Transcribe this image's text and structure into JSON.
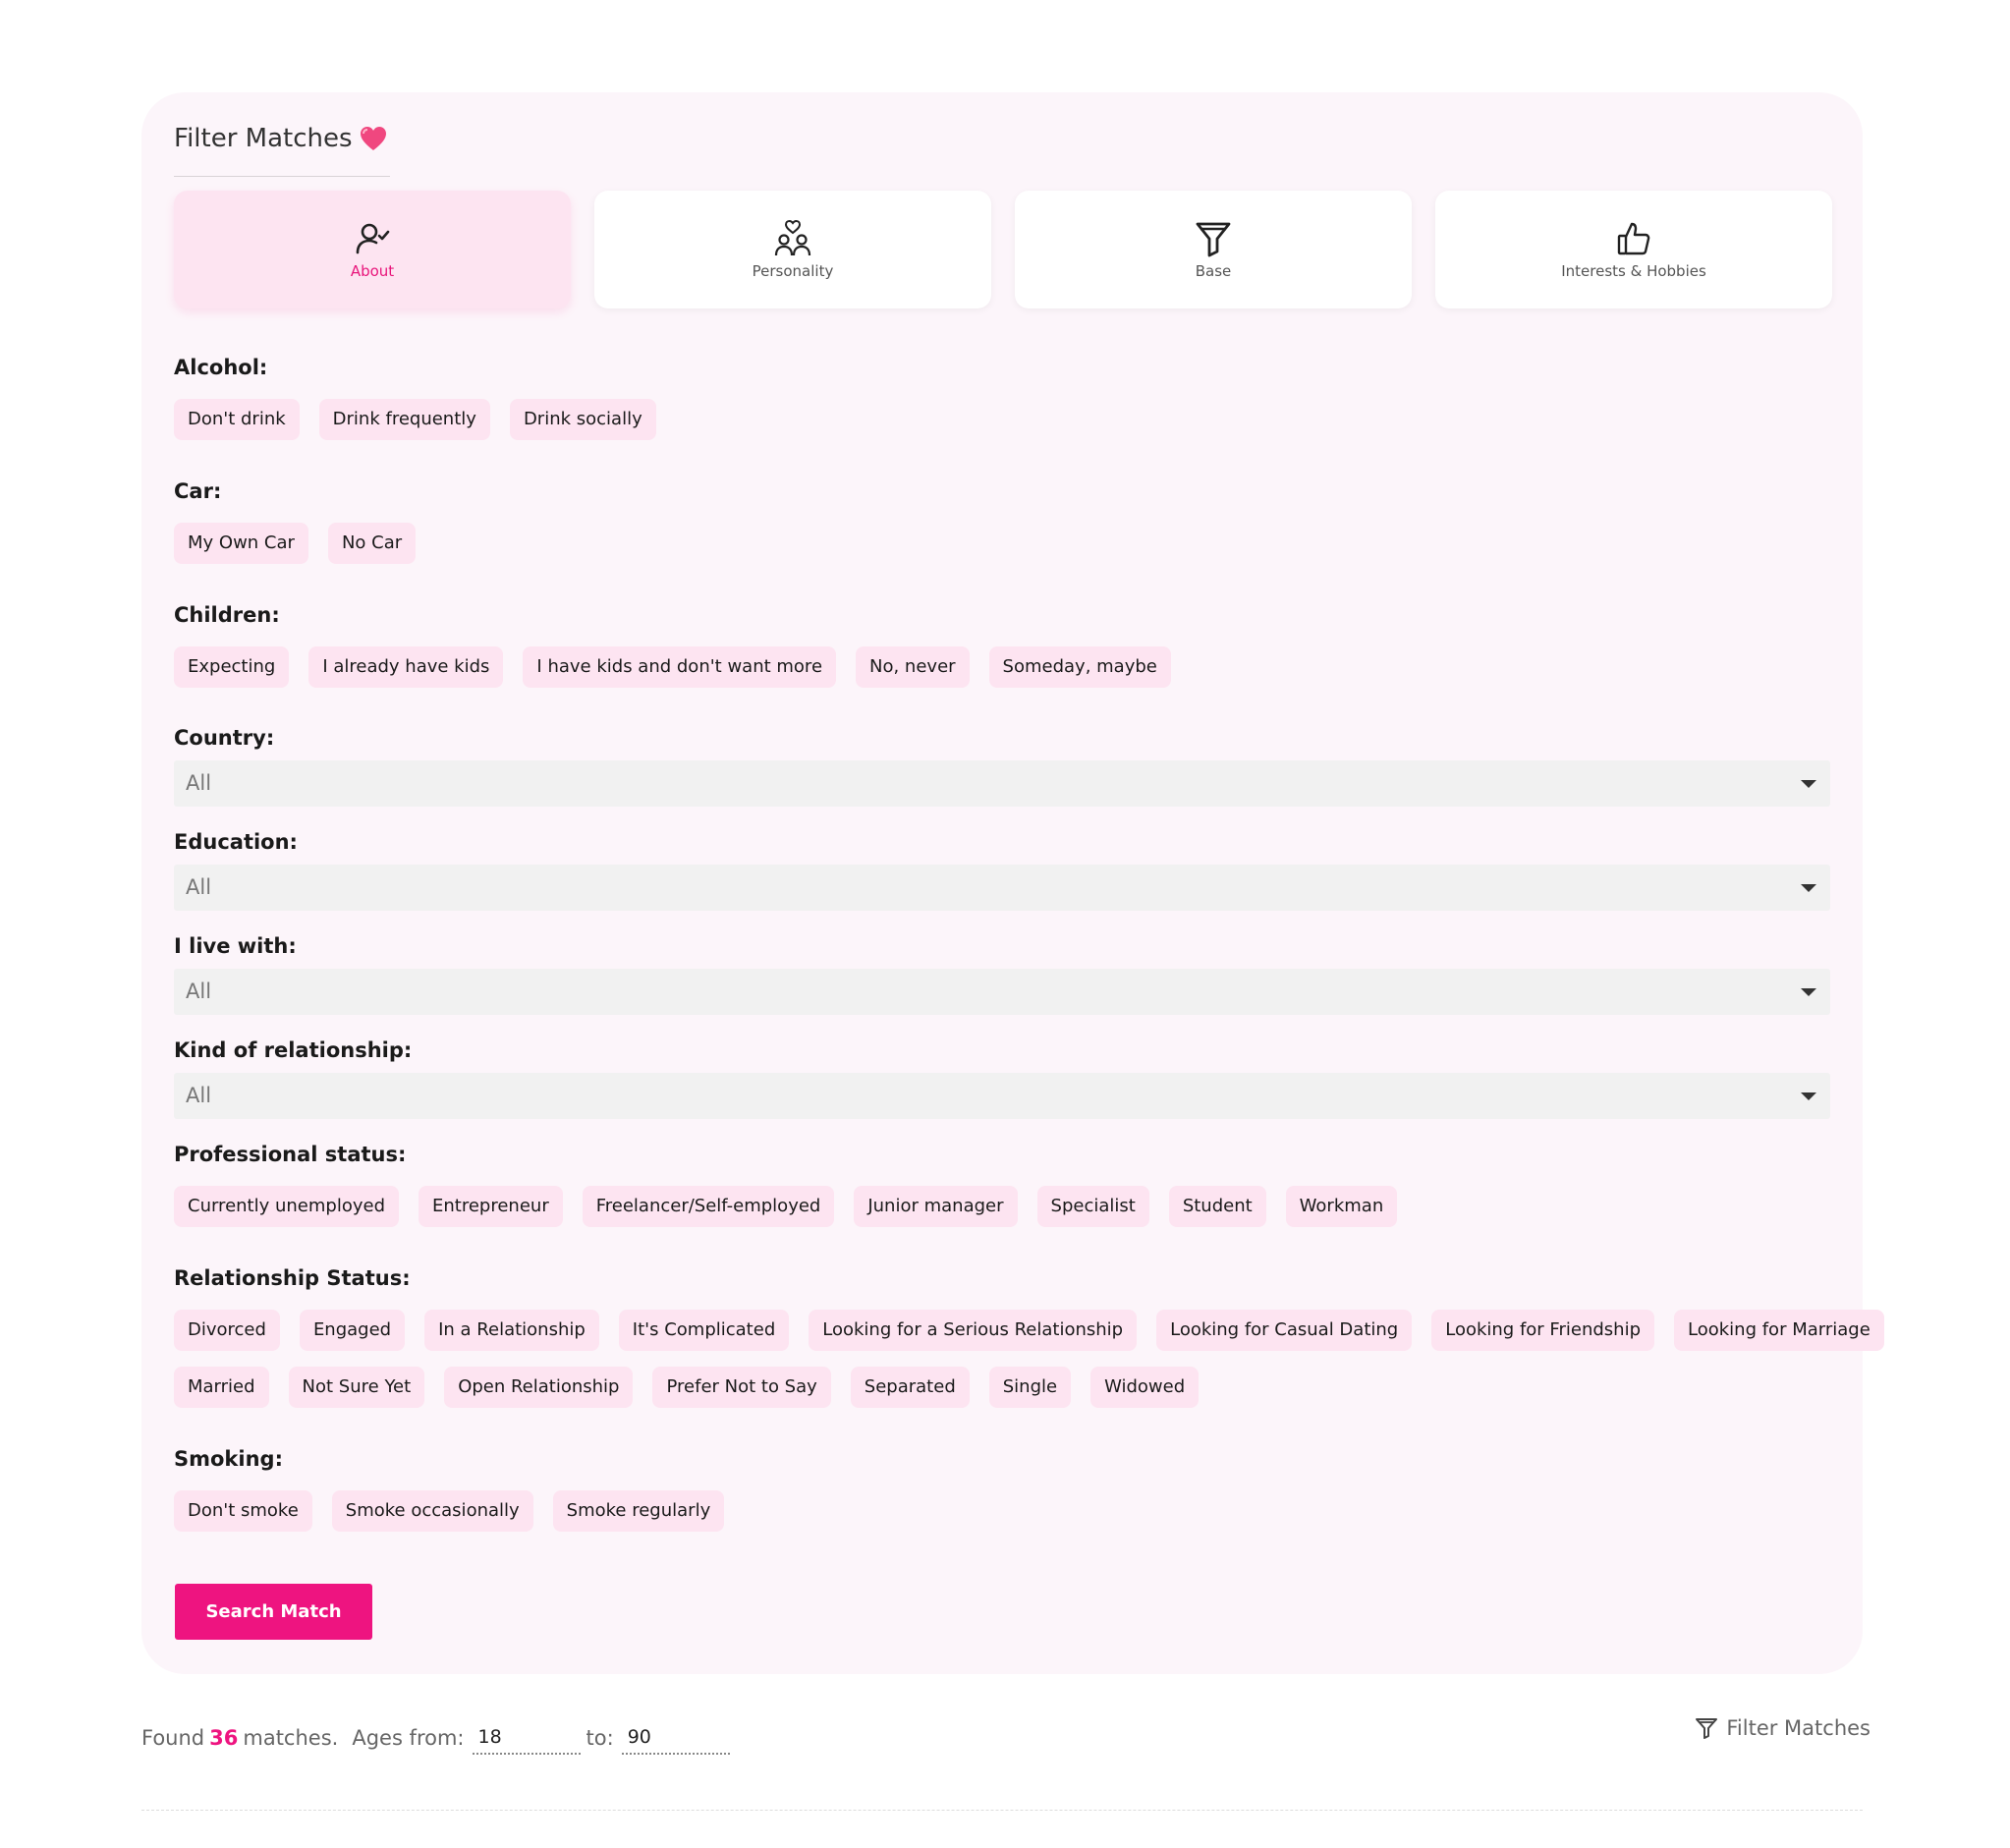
{
  "panel": {
    "title": "Filter Matches"
  },
  "tabs": [
    {
      "label": "About",
      "icon": "user-check-icon",
      "active": true
    },
    {
      "label": "Personality",
      "icon": "couple-heart-icon",
      "active": false
    },
    {
      "label": "Base",
      "icon": "funnel-icon",
      "active": false
    },
    {
      "label": "Interests & Hobbies",
      "icon": "thumbs-up-icon",
      "active": false
    }
  ],
  "alcohol": {
    "label": "Alcohol:",
    "options": [
      "Don't drink",
      "Drink frequently",
      "Drink socially"
    ]
  },
  "car": {
    "label": "Car:",
    "options": [
      "My Own Car",
      "No Car"
    ]
  },
  "children": {
    "label": "Children:",
    "options": [
      "Expecting",
      "I already have kids",
      "I have kids and don't want more",
      "No, never",
      "Someday, maybe"
    ]
  },
  "country": {
    "label": "Country:",
    "value": "All"
  },
  "education": {
    "label": "Education:",
    "value": "All"
  },
  "live_with": {
    "label": "I live with:",
    "value": "All"
  },
  "relationship_kind": {
    "label": "Kind of relationship:",
    "value": "All"
  },
  "professional": {
    "label": "Professional status:",
    "options": [
      "Currently unemployed",
      "Entrepreneur",
      "Freelancer/Self-employed",
      "Junior manager",
      "Specialist",
      "Student",
      "Workman"
    ]
  },
  "relationship_status": {
    "label": "Relationship Status:",
    "row1": [
      "Divorced",
      "Engaged",
      "In a Relationship",
      "It's Complicated",
      "Looking for a Serious Relationship",
      "Looking for Casual Dating",
      "Looking for Friendship",
      "Looking for Marriage"
    ],
    "row2": [
      "Married",
      "Not Sure Yet",
      "Open Relationship",
      "Prefer Not to Say",
      "Separated",
      "Single",
      "Widowed"
    ]
  },
  "smoking": {
    "label": "Smoking:",
    "options": [
      "Don't smoke",
      "Smoke occasionally",
      "Smoke regularly"
    ]
  },
  "search_button": "Search Match",
  "footer": {
    "found_prefix": "Found",
    "count": "36",
    "found_suffix": "matches.",
    "ages_from_label": "Ages from:",
    "age_from": "18",
    "to_label": "to:",
    "age_to": "90",
    "filter_link": "Filter Matches"
  },
  "colors": {
    "accent": "#ee1480",
    "chip_bg": "#fde4f1",
    "panel_bg": "#fcf5fa"
  }
}
